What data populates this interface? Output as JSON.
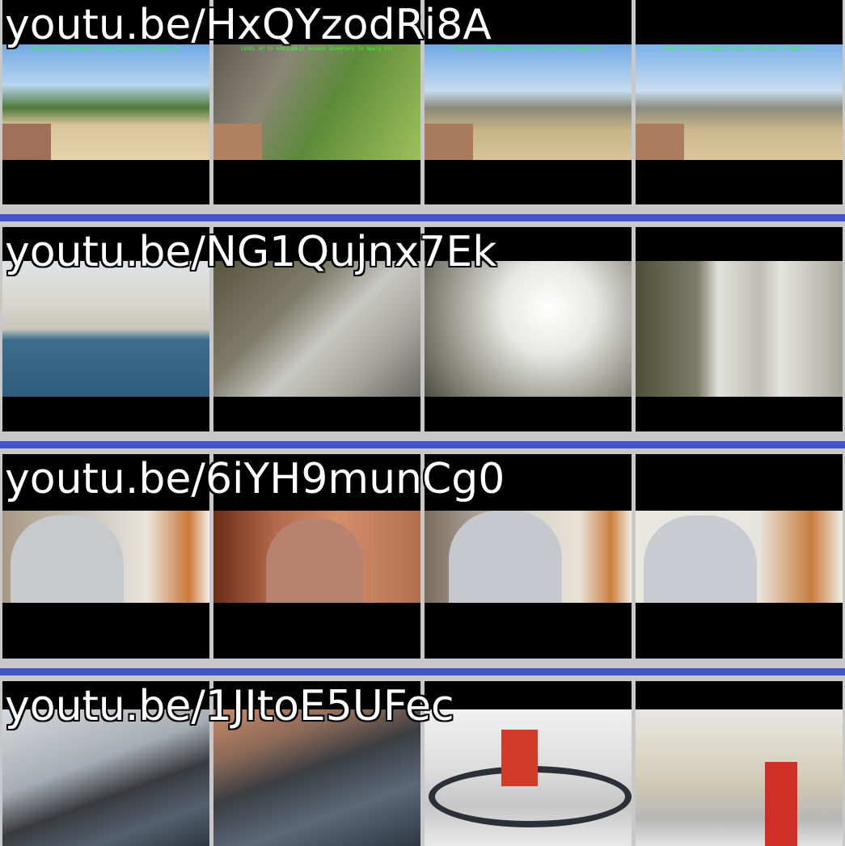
{
  "rows": [
    {
      "url": "youtu.be/HxQYzodRi8A",
      "hud": "LEVEL UP IS AVAILABLE! Access Inventory To Apply It!"
    },
    {
      "url": "youtu.be/NG1Qujnx7Ek"
    },
    {
      "url": "youtu.be/6iYH9munCg0"
    },
    {
      "url": "youtu.be/1JItoE5UFec"
    }
  ],
  "colors": {
    "separator": "#4455cc",
    "background": "#c8c8c8",
    "frame": "#000000"
  }
}
